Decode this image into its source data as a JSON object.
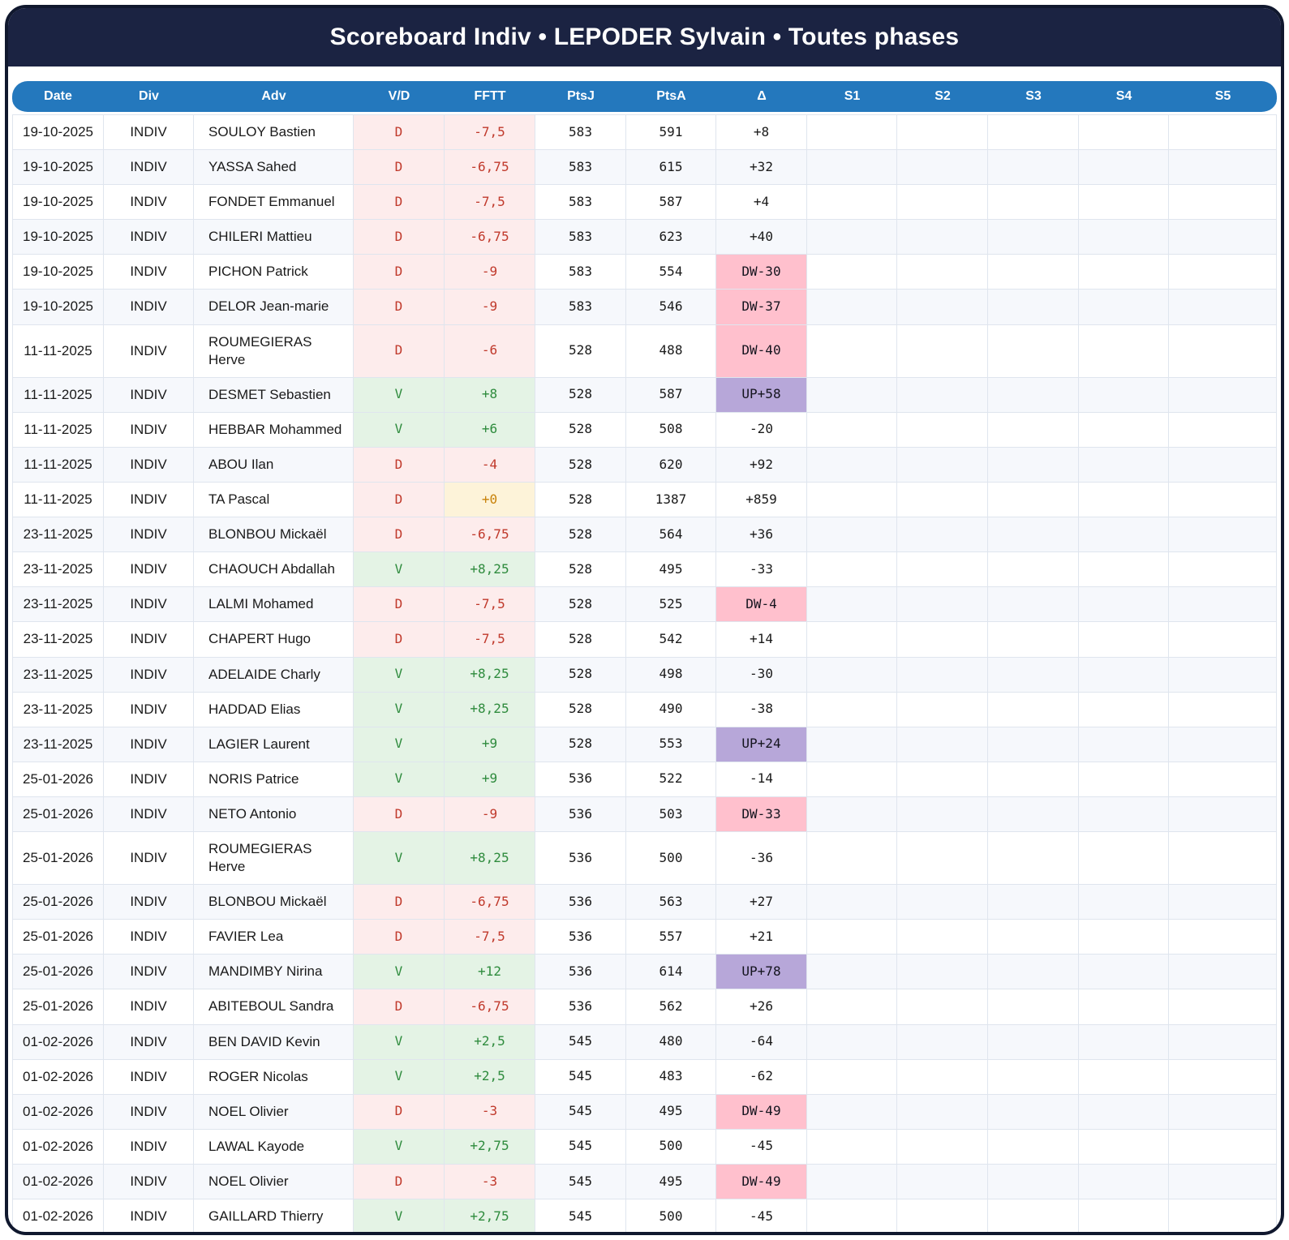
{
  "title": "Scoreboard Indiv • LEPODER Sylvain • Toutes phases",
  "columns": [
    "Date",
    "Div",
    "Adv",
    "V/D",
    "FFTT",
    "PtsJ",
    "PtsA",
    "Δ",
    "S1",
    "S2",
    "S3",
    "S4",
    "S5"
  ],
  "column_keys": [
    "date",
    "div",
    "adv",
    "vd",
    "fftt",
    "ptsj",
    "ptsa",
    "delta",
    "s1",
    "s2",
    "s3",
    "s4",
    "s5"
  ],
  "colors": {
    "frame_border": "#10182e",
    "title_bar_bg": "#1b2342",
    "title_text": "#ffffff",
    "header_row_bg": "#2478bd",
    "header_text": "#ffffff",
    "defeat_text": "#c0392b",
    "defeat_bg": "#fdecec",
    "victory_text": "#2e8b3d",
    "victory_bg": "#e4f3e5",
    "zero_text": "#c8820a",
    "zero_bg": "#fdf3d9",
    "down_badge_bg": "#ffc0cd",
    "up_badge_bg": "#b7a7d9",
    "alt_row_bg": "#f6f8fc",
    "grid_border": "#dfe5ee"
  },
  "rows": [
    {
      "date": "19-10-2025",
      "div": "INDIV",
      "adv": "SOULOY Bastien",
      "vd": "D",
      "fftt": "-7,5",
      "ptsj": "583",
      "ptsa": "591",
      "delta": "+8"
    },
    {
      "date": "19-10-2025",
      "div": "INDIV",
      "adv": "YASSA Sahed",
      "vd": "D",
      "fftt": "-6,75",
      "ptsj": "583",
      "ptsa": "615",
      "delta": "+32"
    },
    {
      "date": "19-10-2025",
      "div": "INDIV",
      "adv": "FONDET Emmanuel",
      "vd": "D",
      "fftt": "-7,5",
      "ptsj": "583",
      "ptsa": "587",
      "delta": "+4"
    },
    {
      "date": "19-10-2025",
      "div": "INDIV",
      "adv": "CHILERI Mattieu",
      "vd": "D",
      "fftt": "-6,75",
      "ptsj": "583",
      "ptsa": "623",
      "delta": "+40"
    },
    {
      "date": "19-10-2025",
      "div": "INDIV",
      "adv": "PICHON Patrick",
      "vd": "D",
      "fftt": "-9",
      "ptsj": "583",
      "ptsa": "554",
      "delta": "DW-30"
    },
    {
      "date": "19-10-2025",
      "div": "INDIV",
      "adv": "DELOR Jean-marie",
      "vd": "D",
      "fftt": "-9",
      "ptsj": "583",
      "ptsa": "546",
      "delta": "DW-37"
    },
    {
      "date": "11-11-2025",
      "div": "INDIV",
      "adv": "ROUMEGIERAS Herve",
      "vd": "D",
      "fftt": "-6",
      "ptsj": "528",
      "ptsa": "488",
      "delta": "DW-40"
    },
    {
      "date": "11-11-2025",
      "div": "INDIV",
      "adv": "DESMET Sebastien",
      "vd": "V",
      "fftt": "+8",
      "ptsj": "528",
      "ptsa": "587",
      "delta": "UP+58"
    },
    {
      "date": "11-11-2025",
      "div": "INDIV",
      "adv": "HEBBAR Mohammed",
      "vd": "V",
      "fftt": "+6",
      "ptsj": "528",
      "ptsa": "508",
      "delta": "-20"
    },
    {
      "date": "11-11-2025",
      "div": "INDIV",
      "adv": "ABOU Ilan",
      "vd": "D",
      "fftt": "-4",
      "ptsj": "528",
      "ptsa": "620",
      "delta": "+92"
    },
    {
      "date": "11-11-2025",
      "div": "INDIV",
      "adv": "TA Pascal",
      "vd": "D",
      "fftt": "+0",
      "ptsj": "528",
      "ptsa": "1387",
      "delta": "+859"
    },
    {
      "date": "23-11-2025",
      "div": "INDIV",
      "adv": "BLONBOU Mickaël",
      "vd": "D",
      "fftt": "-6,75",
      "ptsj": "528",
      "ptsa": "564",
      "delta": "+36"
    },
    {
      "date": "23-11-2025",
      "div": "INDIV",
      "adv": "CHAOUCH Abdallah",
      "vd": "V",
      "fftt": "+8,25",
      "ptsj": "528",
      "ptsa": "495",
      "delta": "-33"
    },
    {
      "date": "23-11-2025",
      "div": "INDIV",
      "adv": "LALMI Mohamed",
      "vd": "D",
      "fftt": "-7,5",
      "ptsj": "528",
      "ptsa": "525",
      "delta": "DW-4"
    },
    {
      "date": "23-11-2025",
      "div": "INDIV",
      "adv": "CHAPERT Hugo",
      "vd": "D",
      "fftt": "-7,5",
      "ptsj": "528",
      "ptsa": "542",
      "delta": "+14"
    },
    {
      "date": "23-11-2025",
      "div": "INDIV",
      "adv": "ADELAIDE Charly",
      "vd": "V",
      "fftt": "+8,25",
      "ptsj": "528",
      "ptsa": "498",
      "delta": "-30"
    },
    {
      "date": "23-11-2025",
      "div": "INDIV",
      "adv": "HADDAD Elias",
      "vd": "V",
      "fftt": "+8,25",
      "ptsj": "528",
      "ptsa": "490",
      "delta": "-38"
    },
    {
      "date": "23-11-2025",
      "div": "INDIV",
      "adv": "LAGIER Laurent",
      "vd": "V",
      "fftt": "+9",
      "ptsj": "528",
      "ptsa": "553",
      "delta": "UP+24"
    },
    {
      "date": "25-01-2026",
      "div": "INDIV",
      "adv": "NORIS Patrice",
      "vd": "V",
      "fftt": "+9",
      "ptsj": "536",
      "ptsa": "522",
      "delta": "-14"
    },
    {
      "date": "25-01-2026",
      "div": "INDIV",
      "adv": "NETO Antonio",
      "vd": "D",
      "fftt": "-9",
      "ptsj": "536",
      "ptsa": "503",
      "delta": "DW-33"
    },
    {
      "date": "25-01-2026",
      "div": "INDIV",
      "adv": "ROUMEGIERAS Herve",
      "vd": "V",
      "fftt": "+8,25",
      "ptsj": "536",
      "ptsa": "500",
      "delta": "-36"
    },
    {
      "date": "25-01-2026",
      "div": "INDIV",
      "adv": "BLONBOU Mickaël",
      "vd": "D",
      "fftt": "-6,75",
      "ptsj": "536",
      "ptsa": "563",
      "delta": "+27"
    },
    {
      "date": "25-01-2026",
      "div": "INDIV",
      "adv": "FAVIER Lea",
      "vd": "D",
      "fftt": "-7,5",
      "ptsj": "536",
      "ptsa": "557",
      "delta": "+21"
    },
    {
      "date": "25-01-2026",
      "div": "INDIV",
      "adv": "MANDIMBY Nirina",
      "vd": "V",
      "fftt": "+12",
      "ptsj": "536",
      "ptsa": "614",
      "delta": "UP+78"
    },
    {
      "date": "25-01-2026",
      "div": "INDIV",
      "adv": "ABITEBOUL Sandra",
      "vd": "D",
      "fftt": "-6,75",
      "ptsj": "536",
      "ptsa": "562",
      "delta": "+26"
    },
    {
      "date": "01-02-2026",
      "div": "INDIV",
      "adv": "BEN DAVID Kevin",
      "vd": "V",
      "fftt": "+2,5",
      "ptsj": "545",
      "ptsa": "480",
      "delta": "-64"
    },
    {
      "date": "01-02-2026",
      "div": "INDIV",
      "adv": "ROGER Nicolas",
      "vd": "V",
      "fftt": "+2,5",
      "ptsj": "545",
      "ptsa": "483",
      "delta": "-62"
    },
    {
      "date": "01-02-2026",
      "div": "INDIV",
      "adv": "NOEL Olivier",
      "vd": "D",
      "fftt": "-3",
      "ptsj": "545",
      "ptsa": "495",
      "delta": "DW-49"
    },
    {
      "date": "01-02-2026",
      "div": "INDIV",
      "adv": "LAWAL Kayode",
      "vd": "V",
      "fftt": "+2,75",
      "ptsj": "545",
      "ptsa": "500",
      "delta": "-45"
    },
    {
      "date": "01-02-2026",
      "div": "INDIV",
      "adv": "NOEL Olivier",
      "vd": "D",
      "fftt": "-3",
      "ptsj": "545",
      "ptsa": "495",
      "delta": "DW-49"
    },
    {
      "date": "01-02-2026",
      "div": "INDIV",
      "adv": "GAILLARD Thierry",
      "vd": "V",
      "fftt": "+2,75",
      "ptsj": "545",
      "ptsa": "500",
      "delta": "-45"
    }
  ]
}
